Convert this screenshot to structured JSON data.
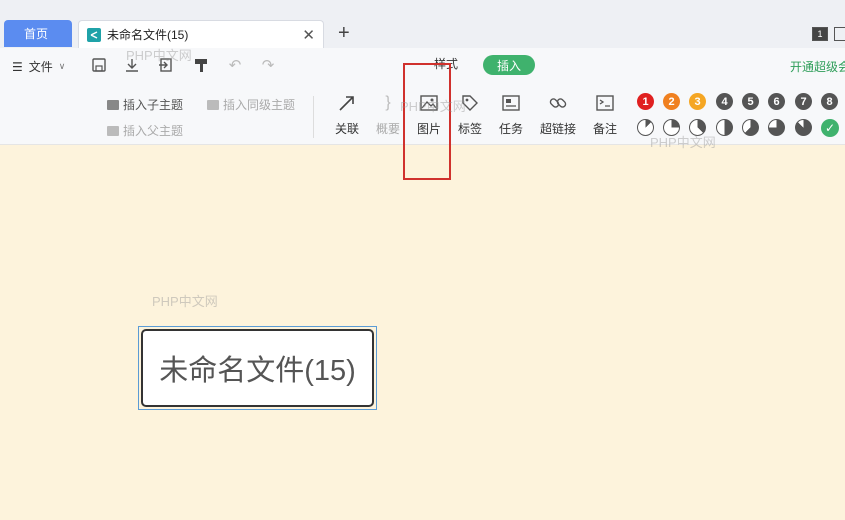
{
  "tabs": {
    "home": "首页",
    "document": "未命名文件(15)",
    "new_tab": "+",
    "close": "✕"
  },
  "window": {
    "badge": "1"
  },
  "toolbar": {
    "file_label": "文件",
    "style_tab": "样式",
    "insert_tab": "插入",
    "vip_label": "开通超级会"
  },
  "insert": {
    "child_topic": "插入子主题",
    "sibling_topic": "插入同级主题",
    "parent_topic": "插入父主题",
    "tools": [
      {
        "label": "关联",
        "icon": "arrow-icon"
      },
      {
        "label": "概要",
        "icon": "brace-icon"
      },
      {
        "label": "图片",
        "icon": "image-icon"
      },
      {
        "label": "标签",
        "icon": "tag-icon"
      },
      {
        "label": "任务",
        "icon": "task-icon"
      },
      {
        "label": "超链接",
        "icon": "link-icon"
      },
      {
        "label": "备注",
        "icon": "note-icon"
      }
    ],
    "priorities": [
      "1",
      "2",
      "3",
      "4",
      "5",
      "6",
      "7",
      "8"
    ],
    "priority_colors": [
      "#e02020",
      "#f08020",
      "#f5a623",
      "#555555",
      "#555555",
      "#555555",
      "#555555",
      "#555555"
    ],
    "progress_levels": [
      0.125,
      0.25,
      0.375,
      0.5,
      0.625,
      0.75,
      0.875
    ]
  },
  "watermarks": {
    "main": "PHP中文网"
  },
  "canvas": {
    "root_node": "未命名文件(15)"
  }
}
